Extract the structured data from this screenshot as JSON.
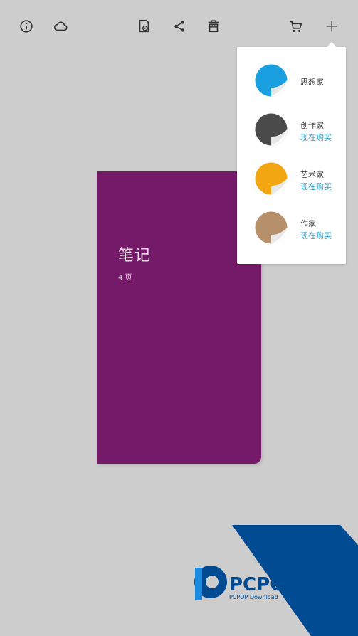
{
  "toolbar": {
    "icons": [
      "info-icon",
      "cloud-icon",
      "page-settings-icon",
      "share-icon",
      "trash-icon",
      "cart-icon",
      "plus-icon"
    ]
  },
  "notebook": {
    "title": "笔记",
    "pages": "4 页",
    "cover_color": "#741a68"
  },
  "popup": {
    "items": [
      {
        "label": "思想家",
        "buy": "",
        "color": "#1a9fe0"
      },
      {
        "label": "创作家",
        "buy": "现在购买",
        "color": "#4a4a4a"
      },
      {
        "label": "艺术家",
        "buy": "现在购买",
        "color": "#f2a712"
      },
      {
        "label": "作家",
        "buy": "现在购买",
        "color": "#b5906b"
      }
    ]
  },
  "watermark": {
    "brand": "PCPOP下载",
    "sub": "PCPOP Download",
    "accent": "#004b91"
  }
}
